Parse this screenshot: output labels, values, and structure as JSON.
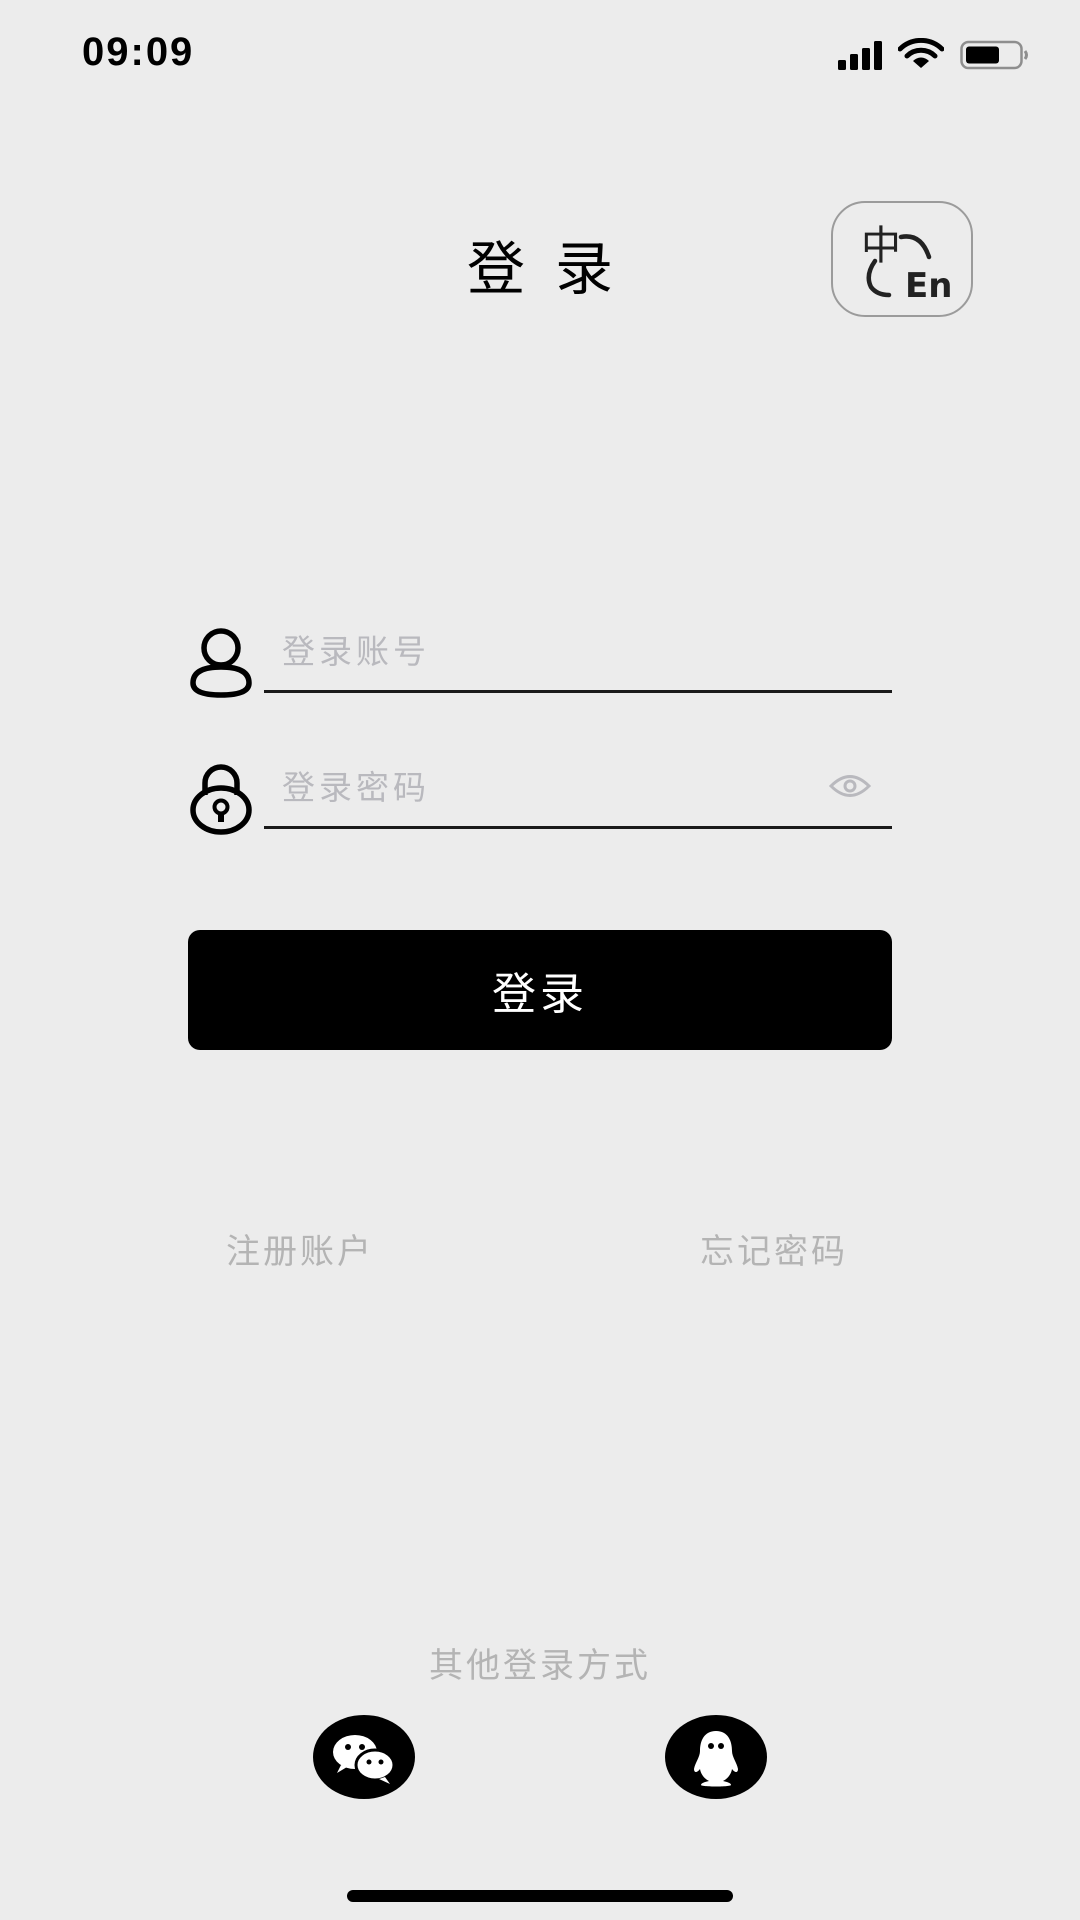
{
  "status_bar": {
    "time": "09:09",
    "icons": [
      "signal-icon",
      "wifi-icon",
      "battery-icon"
    ]
  },
  "header": {
    "title": "登录",
    "language_toggle_icon": "chinese-english-switch-icon",
    "language_glyphs": {
      "zh": "中",
      "en": "En"
    }
  },
  "form": {
    "account_placeholder": "登录账号",
    "password_placeholder": "登录密码",
    "account_icon": "user-icon",
    "password_icon": "lock-icon",
    "password_visibility_icon": "eye-icon",
    "login_label": "登录"
  },
  "links": {
    "register": "注册账户",
    "forgot_password": "忘记密码"
  },
  "other_login": {
    "label": "其他登录方式",
    "providers": [
      "wechat-icon",
      "qq-icon"
    ]
  },
  "colors": {
    "background": "#ececec",
    "primary": "#000000",
    "muted_text": "#b4b4b4",
    "placeholder": "#b9b9be"
  }
}
